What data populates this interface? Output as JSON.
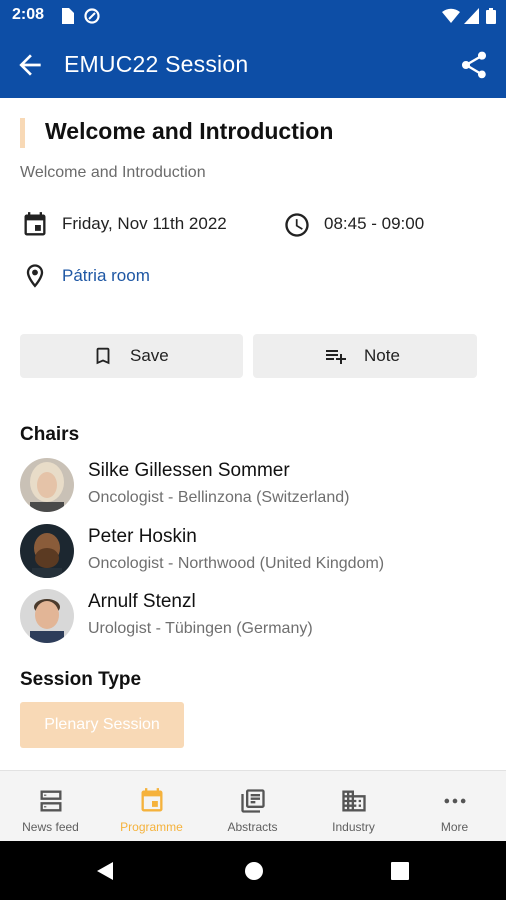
{
  "status_bar": {
    "time": "2:08"
  },
  "app_bar": {
    "title": "EMUC22 Session"
  },
  "session": {
    "title": "Welcome and Introduction",
    "subtitle": "Welcome and Introduction",
    "date": "Friday, Nov 11th 2022",
    "time": "08:45 - 09:00",
    "room": "Pátria room"
  },
  "actions": {
    "save_label": "Save",
    "note_label": "Note"
  },
  "chairs_heading": "Chairs",
  "chairs": [
    {
      "name": "Silke Gillessen Sommer",
      "role": "Oncologist - Bellinzona (Switzerland)"
    },
    {
      "name": "Peter Hoskin",
      "role": "Oncologist - Northwood (United Kingdom)"
    },
    {
      "name": "Arnulf Stenzl",
      "role": "Urologist - Tübingen (Germany)"
    }
  ],
  "session_type_heading": "Session Type",
  "session_type": "Plenary Session",
  "bottom_nav": [
    {
      "label": "News feed",
      "icon": "news-feed-icon"
    },
    {
      "label": "Programme",
      "icon": "calendar-icon",
      "active": true
    },
    {
      "label": "Abstracts",
      "icon": "abstracts-icon"
    },
    {
      "label": "Industry",
      "icon": "building-icon"
    },
    {
      "label": "More",
      "icon": "more-dots-icon"
    }
  ],
  "colors": {
    "primary": "#0d4ea6",
    "accent": "#f5b23c",
    "badge": "#f8d9b6",
    "link": "#1e57a4"
  }
}
